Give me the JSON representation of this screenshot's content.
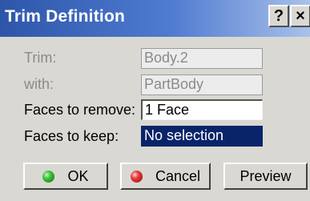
{
  "window": {
    "title": "Trim Definition",
    "help_glyph": "?",
    "close_glyph": "×"
  },
  "form": {
    "trim": {
      "label": "Trim:",
      "value": "Body.2"
    },
    "with": {
      "label": "with:",
      "value": "PartBody"
    },
    "faces_to_remove": {
      "label": "Faces to remove:",
      "value": "1 Face"
    },
    "faces_to_keep": {
      "label": "Faces to keep:",
      "value": "No selection"
    }
  },
  "buttons": {
    "ok_label": "OK",
    "cancel_label": "Cancel",
    "preview_label": "Preview"
  },
  "colors": {
    "titlebar_start": "#2d56a9",
    "selected_field_bg": "#0a246a",
    "ok_icon": "#3cc53c",
    "cancel_icon": "#e83b3b"
  }
}
